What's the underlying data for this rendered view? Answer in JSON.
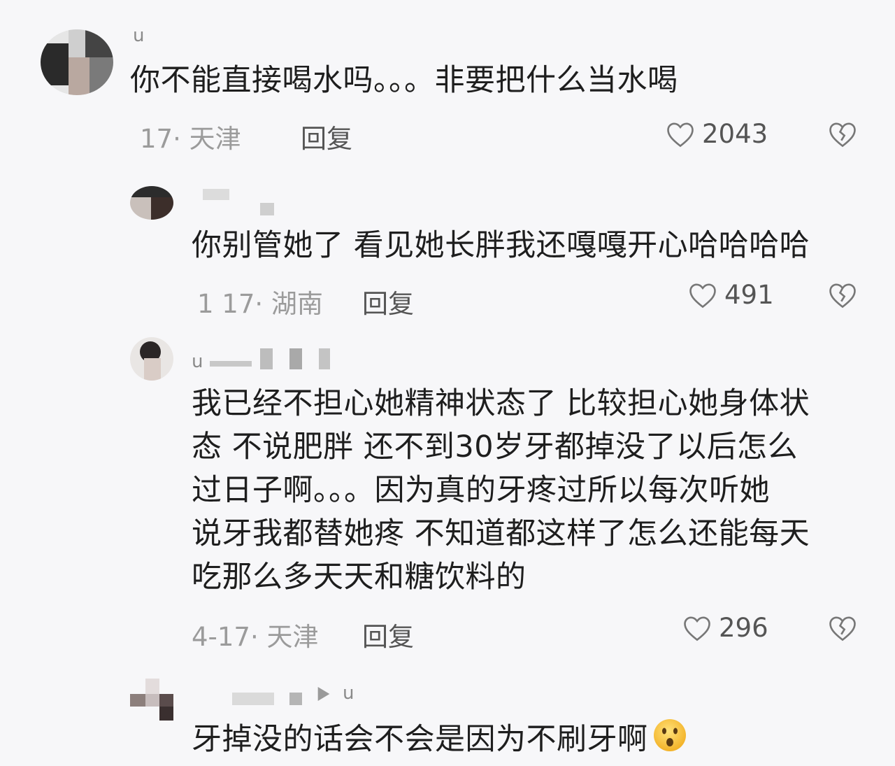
{
  "comments": [
    {
      "username": "u",
      "text": "你不能直接喝水吗。。。非要把什么当水喝",
      "date": "17· 天津",
      "reply_label": "回复",
      "likes": "2043"
    },
    {
      "username": "",
      "text": "你别管她了 看见她长胖我还嘎嘎开心哈哈哈哈",
      "date": "1 17· 湖南",
      "reply_label": "回复",
      "likes": "491"
    },
    {
      "username": "u",
      "text_lines": [
        "我已经不担心她精神状态了 比较担心她身体状",
        "态 不说肥胖 还不到30岁牙都掉没了以后怎么",
        "过日子啊。。。因为真的牙疼过所以每次听她",
        "说牙我都替她疼 不知道都这样了怎么还能每天",
        "吃那么多天天和糖饮料的"
      ],
      "date": "4-17· 天津",
      "reply_label": "回复",
      "likes": "296"
    },
    {
      "username": "u",
      "text": "牙掉没的话会不会是因为不刷牙啊",
      "emoji": "surprised-face-emoji"
    }
  ],
  "colors": {
    "background": "#f7f7f9",
    "text": "#1e1e1e",
    "meta": "#9b9b9b"
  }
}
